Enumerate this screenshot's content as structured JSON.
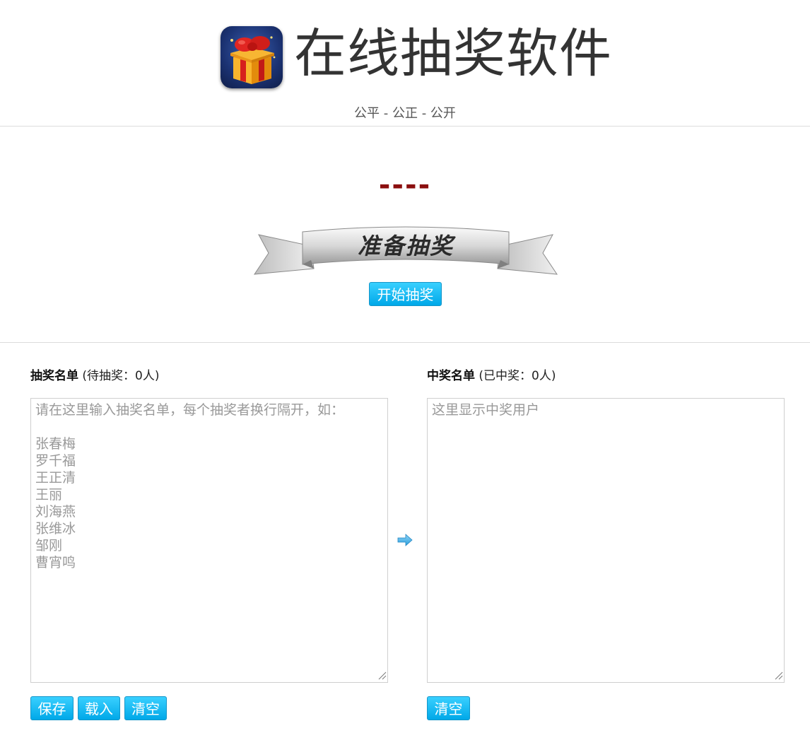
{
  "header": {
    "title": "在线抽奖软件",
    "tagline": "公平 - 公正 - 公开"
  },
  "draw": {
    "display": "----",
    "banner_text": "准备抽奖",
    "start_button": "开始抽奖"
  },
  "participants": {
    "title": "抽奖名单",
    "count_text": "(待抽奖：0人)",
    "placeholder": "请在这里输入抽奖名单，每个抽奖者换行隔开，如：\n\n张春梅\n罗千福\n王正清\n王丽\n刘海燕\n张维冰\n邹刚\n曹宵鸣",
    "buttons": {
      "save": "保存",
      "load": "载入",
      "clear": "清空"
    }
  },
  "winners": {
    "title": "中奖名单",
    "count_text": "(已中奖：0人)",
    "placeholder": "这里显示中奖用户",
    "buttons": {
      "clear": "清空"
    }
  },
  "colors": {
    "accent": "#00a8e8",
    "display": "#8b0f0f",
    "divider": "#dcdcdc"
  },
  "icons": {
    "logo": "gift-box-icon",
    "transfer": "arrow-right-icon"
  }
}
